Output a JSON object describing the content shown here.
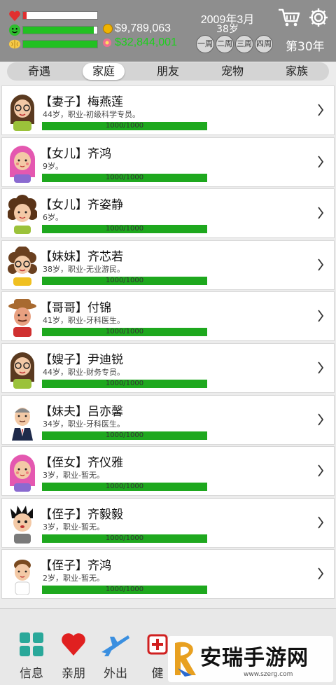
{
  "header": {
    "money": "$9,789,063",
    "money2": "$32,844,001",
    "date": "2009年3月",
    "age": "38岁",
    "weeks": [
      "一周",
      "二周",
      "三周",
      "四周"
    ],
    "year": "第30年",
    "health_level": 0.05,
    "mood_level": 0.95,
    "iq_level": 1.0,
    "colors": {
      "health": "#e03030",
      "mood": "#22c022",
      "iq": "#22c022",
      "money2": "#1cd01c"
    }
  },
  "tabs": [
    "奇遇",
    "家庭",
    "朋友",
    "宠物",
    "家族"
  ],
  "active_tab": "家庭",
  "members": [
    {
      "name": "【妻子】梅燕莲",
      "info": "44岁，职业-初级科学专员。",
      "hp": "1000/1000",
      "avatar": "woman-glasses"
    },
    {
      "name": "【女儿】齐鸿",
      "info": "9岁。",
      "hp": "1000/1000",
      "avatar": "girl-pink-hair"
    },
    {
      "name": "【女儿】齐姿静",
      "info": "6岁。",
      "hp": "1000/1000",
      "avatar": "girl-curly"
    },
    {
      "name": "【妹妹】齐芯若",
      "info": "38岁，职业-无业游民。",
      "hp": "1000/1000",
      "avatar": "woman-glasses-curly"
    },
    {
      "name": "【哥哥】付锦",
      "info": "41岁，职业-牙科医生。",
      "hp": "1000/1000",
      "avatar": "man-hat"
    },
    {
      "name": "【嫂子】尹迪锐",
      "info": "44岁，职业-财务专员。",
      "hp": "1000/1000",
      "avatar": "woman-glasses"
    },
    {
      "name": "【妹夫】吕亦馨",
      "info": "34岁，职业-牙科医生。",
      "hp": "1000/1000",
      "avatar": "man-suit"
    },
    {
      "name": "【侄女】齐仪雅",
      "info": "3岁，职业-暂无。",
      "hp": "1000/1000",
      "avatar": "girl-pink-hair"
    },
    {
      "name": "【侄子】齐毅毅",
      "info": "3岁，职业-暂无。",
      "hp": "1000/1000",
      "avatar": "boy-spiky"
    },
    {
      "name": "【侄子】齐鸿",
      "info": "2岁，职业-暂无。",
      "hp": "1000/1000",
      "avatar": "boy-small"
    }
  ],
  "nav": [
    {
      "label": "信息",
      "icon": "info-grid-icon"
    },
    {
      "label": "亲朋",
      "icon": "heart-icon"
    },
    {
      "label": "外出",
      "icon": "airplane-icon"
    },
    {
      "label": "健",
      "icon": "health-icon"
    }
  ],
  "watermark": {
    "text": "安瑞手游网",
    "url": "www.szerg.com"
  }
}
